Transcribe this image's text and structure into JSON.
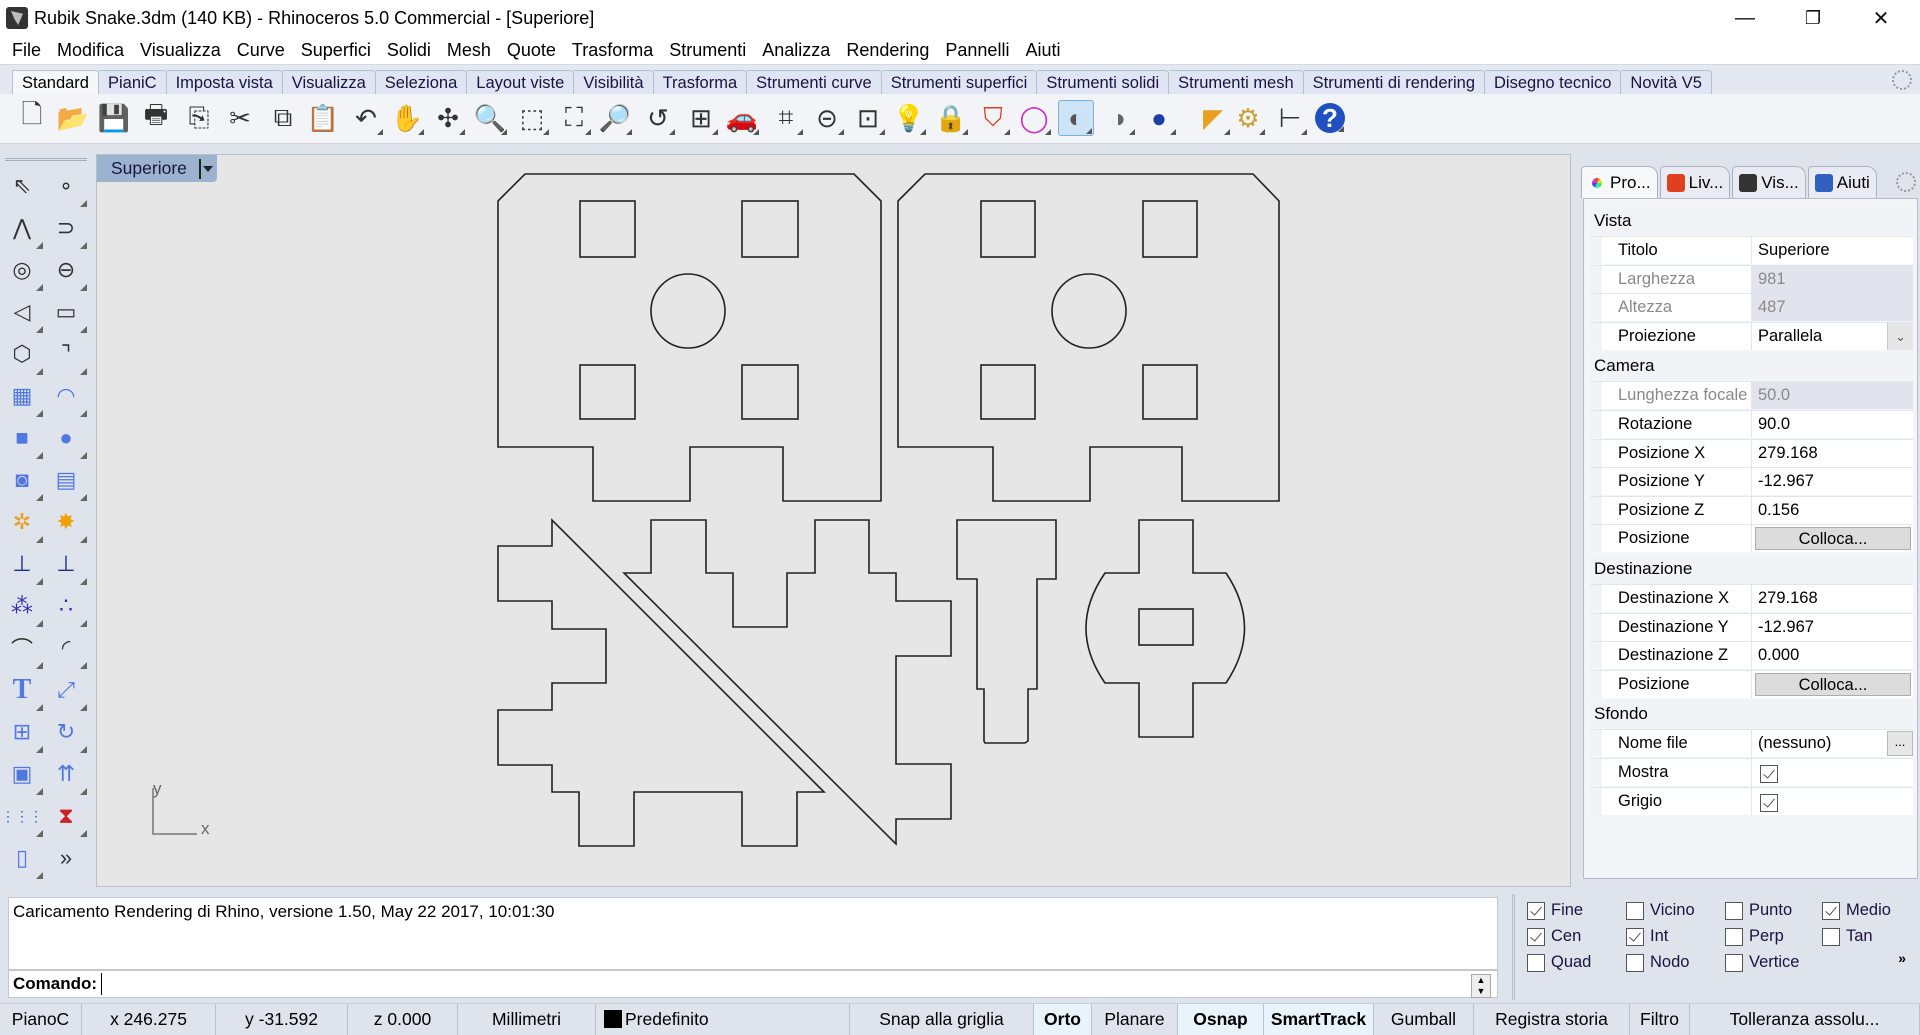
{
  "window": {
    "title": "Rubik Snake.3dm (140 KB) - Rhinoceros 5.0 Commercial - [Superiore]",
    "controls": {
      "minimize": "—",
      "restore": "❐",
      "close": "✕"
    }
  },
  "menu": [
    "File",
    "Modifica",
    "Visualizza",
    "Curve",
    "Superfici",
    "Solidi",
    "Mesh",
    "Quote",
    "Trasforma",
    "Strumenti",
    "Analizza",
    "Rendering",
    "Pannelli",
    "Aiuti"
  ],
  "toolbar_tabs": [
    "Standard",
    "PianiC",
    "Imposta vista",
    "Visualizza",
    "Seleziona",
    "Layout viste",
    "Visibilità",
    "Trasforma",
    "Strumenti curve",
    "Strumenti superfici",
    "Strumenti solidi",
    "Strumenti mesh",
    "Strumenti di rendering",
    "Disegno tecnico",
    "Novità V5"
  ],
  "active_toolbar_tab": "Standard",
  "toolbar_icons": [
    {
      "name": "new-file",
      "glyph": "🗋"
    },
    {
      "name": "open-folder",
      "glyph": "📂"
    },
    {
      "name": "save",
      "glyph": "💾"
    },
    {
      "name": "print",
      "glyph": "🖶"
    },
    {
      "name": "import-export",
      "glyph": "⎘"
    },
    {
      "name": "cut",
      "glyph": "✂"
    },
    {
      "name": "copy",
      "glyph": "⧉"
    },
    {
      "name": "paste",
      "glyph": "📋"
    },
    {
      "name": "undo",
      "glyph": "↶"
    },
    {
      "name": "pan-hand",
      "glyph": "✋"
    },
    {
      "name": "rotate-view",
      "glyph": "✣"
    },
    {
      "name": "zoom-dynamic",
      "glyph": "🔍"
    },
    {
      "name": "zoom-window",
      "glyph": "⬚"
    },
    {
      "name": "zoom-extents",
      "glyph": "⛶"
    },
    {
      "name": "zoom-selected",
      "glyph": "🔎"
    },
    {
      "name": "undo-view",
      "glyph": "↺"
    },
    {
      "name": "four-viewports",
      "glyph": "⊞"
    },
    {
      "name": "car-viewport",
      "glyph": "🚗"
    },
    {
      "name": "cplane-grid",
      "glyph": "⌗"
    },
    {
      "name": "osnap-circle",
      "glyph": "⊝"
    },
    {
      "name": "select-objects",
      "glyph": "⊡"
    },
    {
      "name": "light-bulb",
      "glyph": "💡"
    },
    {
      "name": "lock",
      "glyph": "🔒"
    },
    {
      "name": "layers",
      "glyph": "⛉"
    },
    {
      "name": "color-wheel",
      "glyph": "◯"
    },
    {
      "name": "shaded-sphere",
      "glyph": "◐"
    },
    {
      "name": "render-preview-sphere",
      "glyph": "◑"
    },
    {
      "name": "render-sphere",
      "glyph": "●"
    },
    {
      "name": "spotlight",
      "glyph": "◤"
    },
    {
      "name": "options-gear",
      "glyph": "⚙"
    },
    {
      "name": "dimension",
      "glyph": "⊢"
    },
    {
      "name": "help",
      "glyph": "?"
    }
  ],
  "active_toolbar_icon": "shaded-sphere",
  "left_toolbar": [
    [
      "select-arrow",
      "point"
    ],
    [
      "polyline",
      "curve-control-points"
    ],
    [
      "circle",
      "ellipse"
    ],
    [
      "arc",
      "rectangle"
    ],
    [
      "polygon",
      "fillet-curve"
    ],
    [
      "surface-from-points",
      "extrude-surface"
    ],
    [
      "box-solid",
      "sphere-solid"
    ],
    [
      "cylinder-solid",
      "mesh-surface"
    ],
    [
      "boolean-puzzle",
      "explode"
    ],
    [
      "trim",
      "split"
    ],
    [
      "group",
      "ungroup"
    ],
    [
      "offset-curve",
      "offset-dotted"
    ],
    [
      "text",
      "move"
    ],
    [
      "array-squares",
      "rotate"
    ],
    [
      "solid-edit",
      "extrude-arrows"
    ],
    [
      "rectangular-array",
      "mirror"
    ],
    [
      "orient-solid",
      "more-tools"
    ]
  ],
  "left_toolbar_glyphs": {
    "select-arrow": "⇖",
    "point": "∘",
    "polyline": "⋀",
    "curve-control-points": "⊃",
    "circle": "◎",
    "ellipse": "⊖",
    "arc": "◁",
    "rectangle": "▭",
    "polygon": "⬡",
    "fillet-curve": "⌝",
    "surface-from-points": "▦",
    "extrude-surface": "◠",
    "box-solid": "■",
    "sphere-solid": "●",
    "cylinder-solid": "◙",
    "mesh-surface": "▤",
    "boolean-puzzle": "✲",
    "explode": "✸",
    "trim": "⊥",
    "split": "⊥",
    "group": "⁂",
    "ungroup": "∴",
    "offset-curve": "⌒",
    "offset-dotted": "◜",
    "text": "T",
    "move": "⤢",
    "array-squares": "⊞",
    "rotate": "↻",
    "solid-edit": "▣",
    "extrude-arrows": "⇈",
    "rectangular-array": "⋮⋮⋮",
    "mirror": "⧗",
    "orient-solid": "▯",
    "more-tools": "»"
  },
  "viewport": {
    "label": "Superiore",
    "axis_x": "x",
    "axis_y": "y"
  },
  "right_panel": {
    "tabs": [
      {
        "label": "Pro...",
        "icon": "color-wheel",
        "color": "#d33"
      },
      {
        "label": "Liv...",
        "icon": "layers",
        "color": "#e04020"
      },
      {
        "label": "Vis...",
        "icon": "monitor",
        "color": "#333"
      },
      {
        "label": "Aiuti",
        "icon": "help",
        "color": "#3060c0"
      }
    ],
    "sections": {
      "vista": {
        "title": "Vista",
        "rows": [
          {
            "key": "Titolo",
            "value": "Superiore"
          },
          {
            "key": "Larghezza",
            "value": "981",
            "readonly": true
          },
          {
            "key": "Altezza",
            "value": "487",
            "readonly": true
          },
          {
            "key": "Proiezione",
            "value": "Parallela",
            "dropdown": true
          }
        ]
      },
      "camera": {
        "title": "Camera",
        "rows": [
          {
            "key": "Lunghezza focale",
            "value": "50.0",
            "readonly": true
          },
          {
            "key": "Rotazione",
            "value": "90.0"
          },
          {
            "key": "Posizione X",
            "value": "279.168"
          },
          {
            "key": "Posizione Y",
            "value": "-12.967"
          },
          {
            "key": "Posizione Z",
            "value": "0.156"
          },
          {
            "key": "Posizione",
            "button": "Colloca..."
          }
        ]
      },
      "destinazione": {
        "title": "Destinazione",
        "rows": [
          {
            "key": "Destinazione X",
            "value": "279.168"
          },
          {
            "key": "Destinazione Y",
            "value": "-12.967"
          },
          {
            "key": "Destinazione Z",
            "value": "0.000"
          },
          {
            "key": "Posizione",
            "button": "Colloca..."
          }
        ]
      },
      "sfondo": {
        "title": "Sfondo",
        "rows": [
          {
            "key": "Nome file",
            "value": "(nessuno)",
            "browse": "..."
          },
          {
            "key": "Mostra",
            "checked": true
          },
          {
            "key": "Grigio",
            "checked": true
          }
        ]
      }
    }
  },
  "command": {
    "history": "Caricamento Rendering di Rhino, versione 1.50, May 22 2017, 10:01:30",
    "prompt": "Comando:",
    "value": ""
  },
  "osnap": {
    "items": [
      {
        "label": "Fine",
        "checked": true
      },
      {
        "label": "Vicino",
        "checked": false
      },
      {
        "label": "Punto",
        "checked": false
      },
      {
        "label": "Medio",
        "checked": true
      },
      {
        "label": "Cen",
        "checked": true
      },
      {
        "label": "Int",
        "checked": true
      },
      {
        "label": "Perp",
        "checked": false
      },
      {
        "label": "Tan",
        "checked": false
      },
      {
        "label": "Quad",
        "checked": false
      },
      {
        "label": "Nodo",
        "checked": false
      },
      {
        "label": "Vertice",
        "checked": false
      }
    ],
    "more": "»"
  },
  "statusbar": [
    {
      "label": "PianoC"
    },
    {
      "label": "x 246.275"
    },
    {
      "label": "y -31.592"
    },
    {
      "label": "z 0.000"
    },
    {
      "label": "Millimetri"
    },
    {
      "label": "Predefinito",
      "swatch": "#000000"
    },
    {
      "label": "Snap alla griglia"
    },
    {
      "label": "Orto",
      "active": true
    },
    {
      "label": "Planare"
    },
    {
      "label": "Osnap",
      "active": true
    },
    {
      "label": "SmartTrack",
      "active": true
    },
    {
      "label": "Gumball"
    },
    {
      "label": "Registra storia"
    },
    {
      "label": "Filtro"
    },
    {
      "label": "Tolleranza assolu..."
    }
  ]
}
